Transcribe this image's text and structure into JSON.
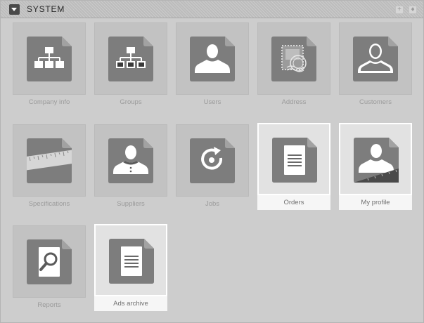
{
  "panel": {
    "title": "SYSTEM",
    "buttons": [
      "+",
      "♦"
    ]
  },
  "tiles": [
    {
      "label": "Company info",
      "icon": "org-chart-icon",
      "selected": false
    },
    {
      "label": "Groups",
      "icon": "groups-icon",
      "selected": false
    },
    {
      "label": "Users",
      "icon": "user-icon",
      "selected": false
    },
    {
      "label": "Address",
      "icon": "stamp-icon",
      "selected": false
    },
    {
      "label": "Customers",
      "icon": "customer-icon",
      "selected": false
    },
    {
      "label": "Specifications",
      "icon": "ruler-icon",
      "selected": false
    },
    {
      "label": "Suppliers",
      "icon": "supplier-icon",
      "selected": false
    },
    {
      "label": "Jobs",
      "icon": "refresh-icon",
      "selected": false
    },
    {
      "label": "Orders",
      "icon": "document-icon",
      "selected": true
    },
    {
      "label": "My profile",
      "icon": "profile-icon",
      "selected": true
    },
    {
      "label": "Reports",
      "icon": "report-search-icon",
      "selected": false
    },
    {
      "label": "Ads archive",
      "icon": "archive-document-icon",
      "selected": true
    }
  ],
  "colors": {
    "panel_bg": "#cdcdcd",
    "tile_bg": "#c2c2c2",
    "tile_selected_bg": "#e2e2e2",
    "icon_dark": "#7d7d7d",
    "icon_light": "#ffffff"
  }
}
